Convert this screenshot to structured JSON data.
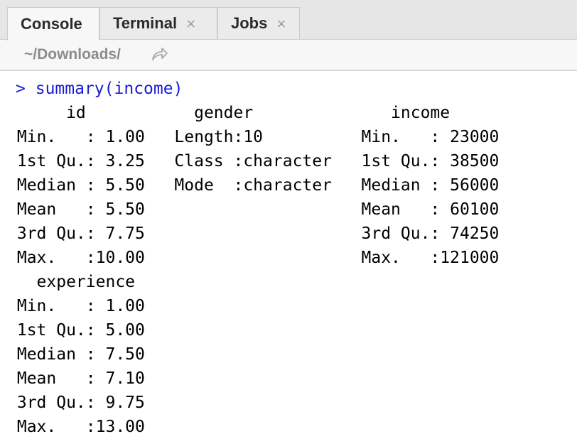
{
  "tabs": [
    {
      "label": "Console",
      "closable": false,
      "active": true
    },
    {
      "label": "Terminal",
      "closable": true,
      "close_glyph": "×",
      "active": false
    },
    {
      "label": "Jobs",
      "closable": true,
      "close_glyph": "×",
      "active": false
    }
  ],
  "toolbar": {
    "path": "~/Downloads/",
    "goto_icon": "goto-directory-arrow-icon"
  },
  "console": {
    "prompt": ">",
    "command": "summary(income)",
    "output_lines": [
      "      id           gender              income      ",
      " Min.   : 1.00   Length:10          Min.   : 23000  ",
      " 1st Qu.: 3.25   Class :character   1st Qu.: 38500  ",
      " Median : 5.50   Mode  :character   Median : 56000  ",
      " Mean   : 5.50                      Mean   : 60100  ",
      " 3rd Qu.: 7.75                      3rd Qu.: 74250  ",
      " Max.   :10.00                      Max.   :121000  ",
      "   experience   ",
      " Min.   : 1.00  ",
      " 1st Qu.: 5.00  ",
      " Median : 7.50  ",
      " Mean   : 7.10  ",
      " 3rd Qu.: 9.75  ",
      " Max.   :13.00  "
    ]
  },
  "colors": {
    "command": "#1a1ad6",
    "output": "#000000",
    "tab_bar": "#e6e6e6",
    "active_tab": "#f7f7f7",
    "path_text": "#8c8c8c"
  }
}
